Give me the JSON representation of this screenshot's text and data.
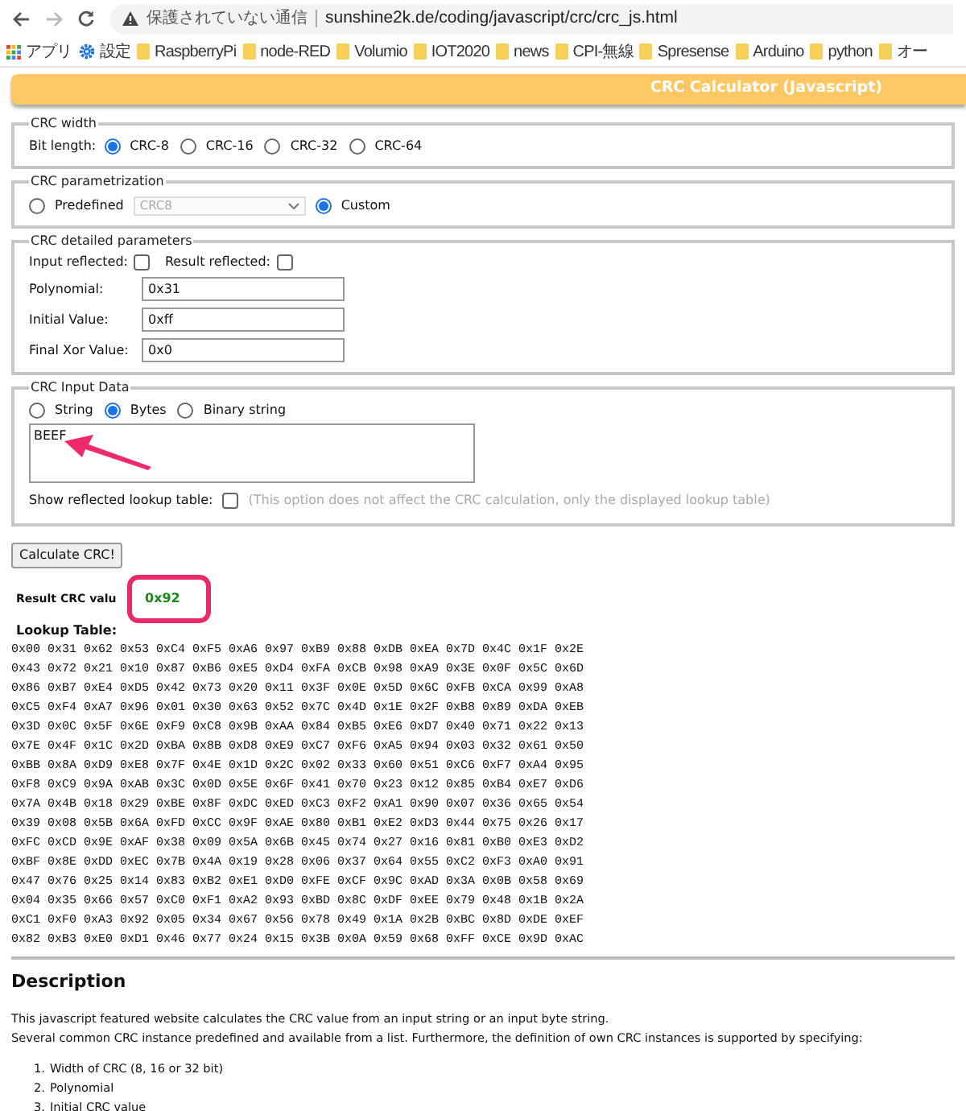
{
  "browser": {
    "security": "保護されていない通信",
    "url": "sunshine2k.de/coding/javascript/crc/crc_js.html",
    "bookmarks": [
      {
        "kind": "apps",
        "label": "アプリ"
      },
      {
        "kind": "settings",
        "label": "設定"
      },
      {
        "kind": "folder",
        "label": "RaspberryPi"
      },
      {
        "kind": "folder",
        "label": "node-RED"
      },
      {
        "kind": "folder",
        "label": "Volumio"
      },
      {
        "kind": "folder",
        "label": "IOT2020"
      },
      {
        "kind": "folder",
        "label": "news"
      },
      {
        "kind": "folder",
        "label": "CPI-無線"
      },
      {
        "kind": "folder",
        "label": "Spresense"
      },
      {
        "kind": "folder",
        "label": "Arduino"
      },
      {
        "kind": "folder",
        "label": "python"
      },
      {
        "kind": "folder",
        "label": "オー"
      }
    ]
  },
  "title": "CRC Calculator (Javascript)",
  "crc_width": {
    "legend": "CRC width",
    "label": "Bit length:",
    "options": [
      {
        "label": "CRC-8",
        "selected": true
      },
      {
        "label": "CRC-16",
        "selected": false
      },
      {
        "label": "CRC-32",
        "selected": false
      },
      {
        "label": "CRC-64",
        "selected": false
      }
    ]
  },
  "parametrization": {
    "legend": "CRC parametrization",
    "predefined": {
      "label": "Predefined",
      "selected": false
    },
    "select": {
      "value": "CRC8",
      "disabled": true
    },
    "custom": {
      "label": "Custom",
      "selected": true
    }
  },
  "detailed": {
    "legend": "CRC detailed parameters",
    "checks": [
      {
        "label": "Input reflected:",
        "checked": false
      },
      {
        "label": "Result reflected:",
        "checked": false
      }
    ],
    "fields": [
      {
        "label": "Polynomial:",
        "value": "0x31"
      },
      {
        "label": "Initial Value:",
        "value": "0xff"
      },
      {
        "label": "Final Xor Value:",
        "value": "0x0"
      }
    ]
  },
  "input_data": {
    "legend": "CRC Input Data",
    "options": [
      {
        "label": "String",
        "selected": false
      },
      {
        "label": "Bytes",
        "selected": true
      },
      {
        "label": "Binary string",
        "selected": false
      }
    ],
    "value": "BEEF",
    "reflected": {
      "label": "Show reflected lookup table:",
      "checked": false,
      "note": "(This option does not affect the CRC calculation, only the displayed lookup table)"
    }
  },
  "button": "Calculate CRC!",
  "result": {
    "label": "Result CRC valu",
    "value": "0x92"
  },
  "lookup": {
    "label": "Lookup Table:",
    "rows": [
      "0x00 0x31 0x62 0x53 0xC4 0xF5 0xA6 0x97 0xB9 0x88 0xDB 0xEA 0x7D 0x4C 0x1F 0x2E",
      "0x43 0x72 0x21 0x10 0x87 0xB6 0xE5 0xD4 0xFA 0xCB 0x98 0xA9 0x3E 0x0F 0x5C 0x6D",
      "0x86 0xB7 0xE4 0xD5 0x42 0x73 0x20 0x11 0x3F 0x0E 0x5D 0x6C 0xFB 0xCA 0x99 0xA8",
      "0xC5 0xF4 0xA7 0x96 0x01 0x30 0x63 0x52 0x7C 0x4D 0x1E 0x2F 0xB8 0x89 0xDA 0xEB",
      "0x3D 0x0C 0x5F 0x6E 0xF9 0xC8 0x9B 0xAA 0x84 0xB5 0xE6 0xD7 0x40 0x71 0x22 0x13",
      "0x7E 0x4F 0x1C 0x2D 0xBA 0x8B 0xD8 0xE9 0xC7 0xF6 0xA5 0x94 0x03 0x32 0x61 0x50",
      "0xBB 0x8A 0xD9 0xE8 0x7F 0x4E 0x1D 0x2C 0x02 0x33 0x60 0x51 0xC6 0xF7 0xA4 0x95",
      "0xF8 0xC9 0x9A 0xAB 0x3C 0x0D 0x5E 0x6F 0x41 0x70 0x23 0x12 0x85 0xB4 0xE7 0xD6",
      "0x7A 0x4B 0x18 0x29 0xBE 0x8F 0xDC 0xED 0xC3 0xF2 0xA1 0x90 0x07 0x36 0x65 0x54",
      "0x39 0x08 0x5B 0x6A 0xFD 0xCC 0x9F 0xAE 0x80 0xB1 0xE2 0xD3 0x44 0x75 0x26 0x17",
      "0xFC 0xCD 0x9E 0xAF 0x38 0x09 0x5A 0x6B 0x45 0x74 0x27 0x16 0x81 0xB0 0xE3 0xD2",
      "0xBF 0x8E 0xDD 0xEC 0x7B 0x4A 0x19 0x28 0x06 0x37 0x64 0x55 0xC2 0xF3 0xA0 0x91",
      "0x47 0x76 0x25 0x14 0x83 0xB2 0xE1 0xD0 0xFE 0xCF 0x9C 0xAD 0x3A 0x0B 0x58 0x69",
      "0x04 0x35 0x66 0x57 0xC0 0xF1 0xA2 0x93 0xBD 0x8C 0xDF 0xEE 0x79 0x48 0x1B 0x2A",
      "0xC1 0xF0 0xA3 0x92 0x05 0x34 0x67 0x56 0x78 0x49 0x1A 0x2B 0xBC 0x8D 0xDE 0xEF",
      "0x82 0xB3 0xE0 0xD1 0x46 0x77 0x24 0x15 0x3B 0x0A 0x59 0x68 0xFF 0xCE 0x9D 0xAC"
    ]
  },
  "description": {
    "heading": "Description",
    "paragraphs": [
      "This javascript featured website calculates the CRC value from an input string or an input byte string.",
      "Several common CRC instance predefined and available from a list. Furthermore, the definition of own CRC instances is supported by specifying:"
    ],
    "list": [
      {
        "number": "1.",
        "text": "Width of CRC (8, 16 or 32 bit)"
      },
      {
        "number": "2.",
        "text": "Polynomial"
      },
      {
        "number": "3.",
        "text": "Initial CRC value"
      }
    ]
  }
}
